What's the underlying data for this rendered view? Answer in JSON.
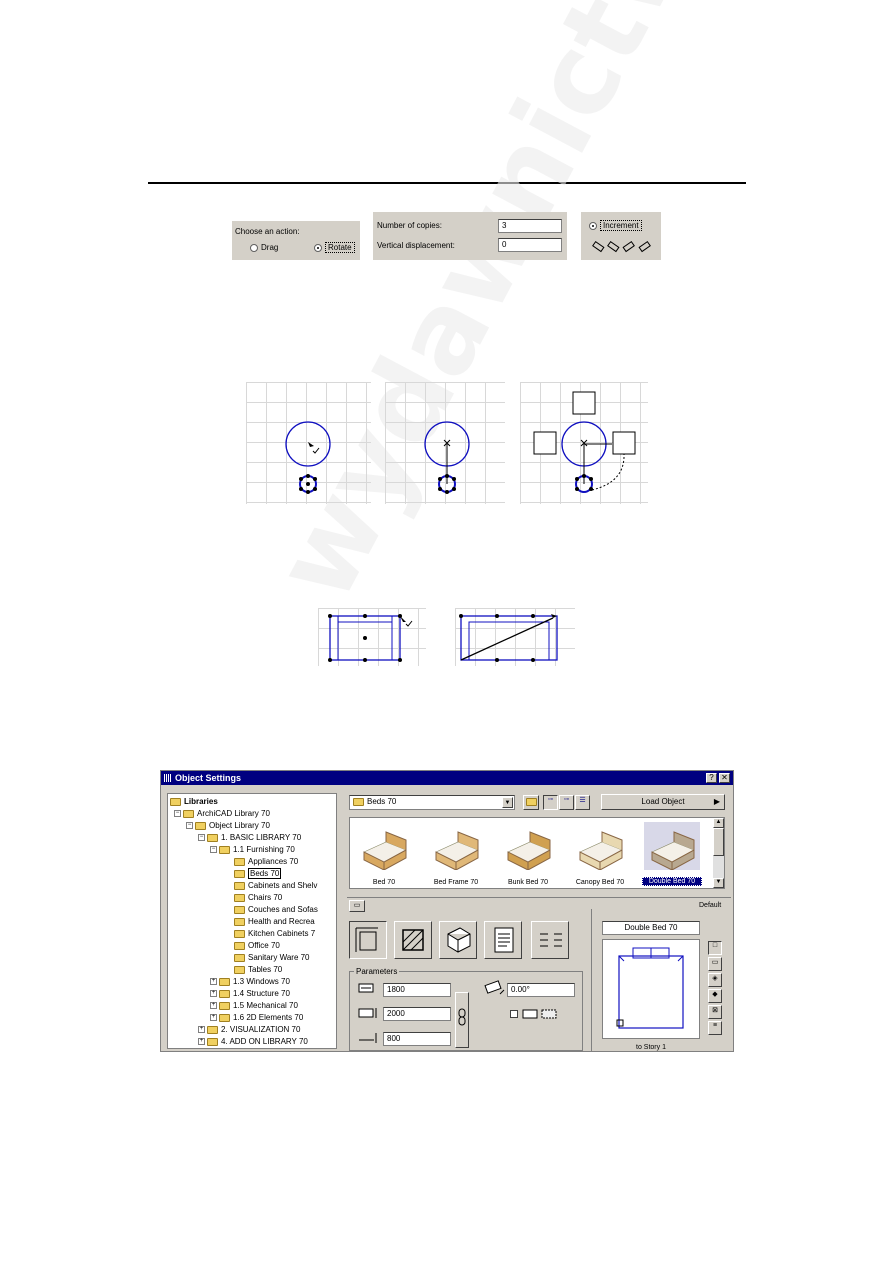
{
  "toolbox_action": {
    "prompt": "Choose an action:",
    "options": [
      "Drag",
      "Rotate"
    ],
    "selected": "Rotate"
  },
  "copies_panel": {
    "copies_label": "Number of copies:",
    "copies_value": "3",
    "displacement_label": "Vertical displacement:",
    "displacement_value": "0"
  },
  "increment_panel": {
    "option_label": "Increment"
  },
  "object_settings": {
    "title": "Object Settings",
    "help_btn": "?",
    "close_btn": "✕",
    "tree": [
      {
        "label": "Libraries",
        "bold": true
      },
      {
        "label": "ArchiCAD Library 70"
      },
      {
        "label": "Object Library 70"
      },
      {
        "label": "1. BASIC LIBRARY 70"
      },
      {
        "label": "1.1 Furnishing 70"
      },
      {
        "label": "Appliances 70"
      },
      {
        "label": "Beds 70"
      },
      {
        "label": "Cabinets and Shelv"
      },
      {
        "label": "Chairs 70"
      },
      {
        "label": "Couches and Sofas"
      },
      {
        "label": "Health and Recrea"
      },
      {
        "label": "Kitchen Cabinets 7"
      },
      {
        "label": "Office 70"
      },
      {
        "label": "Sanitary Ware 70"
      },
      {
        "label": "Tables 70"
      },
      {
        "label": "1.3 Windows 70"
      },
      {
        "label": "1.4 Structure 70"
      },
      {
        "label": "1.5 Mechanical 70"
      },
      {
        "label": "1.6 2D Elements 70"
      },
      {
        "label": "2. VISUALIZATION 70"
      },
      {
        "label": "4. ADD ON LIBRARY 70"
      }
    ],
    "folder_select": "Beds 70",
    "load_object": "Load Object",
    "thumbnails": [
      "Bed 70",
      "Bed Frame 70",
      "Bunk Bed 70",
      "Canopy Bed 70",
      "Double Bed 70"
    ],
    "selected_thumbnail": "Double Bed 70",
    "default_label": "Default",
    "preview_title": "Double Bed 70",
    "params_label": "Parameters",
    "param_a": "1800",
    "param_b": "2000",
    "param_height": "800",
    "angle": "0.00°",
    "story_label": "to Story 1"
  },
  "watermark": "wydawnictwo helion"
}
